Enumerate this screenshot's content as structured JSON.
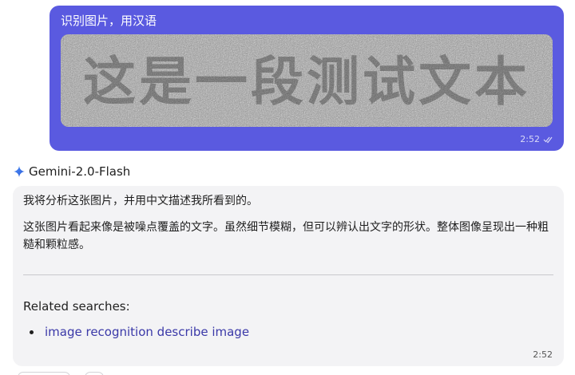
{
  "user_message": {
    "text": "识别图片，用汉语",
    "image_hidden_text": "这是一段测试文本",
    "time": "2:52"
  },
  "bot": {
    "name": "Gemini-2.0-Flash",
    "icon": "gemini-sparkle-icon",
    "paragraphs": [
      "我将分析这张图片，并用中文描述我所看到的。",
      "这张图片看起来像是被噪点覆盖的文字。虽然细节模糊，但可以辨认出文字的形状。整体图像呈现出一种粗糙和颗粒感。"
    ],
    "related_title": "Related searches:",
    "related_links": [
      "image recognition describe image"
    ],
    "time": "2:52"
  },
  "colors": {
    "user_bubble": "#5a5ae0",
    "bot_bubble": "#f3f3f5",
    "link": "#3a38a8"
  }
}
